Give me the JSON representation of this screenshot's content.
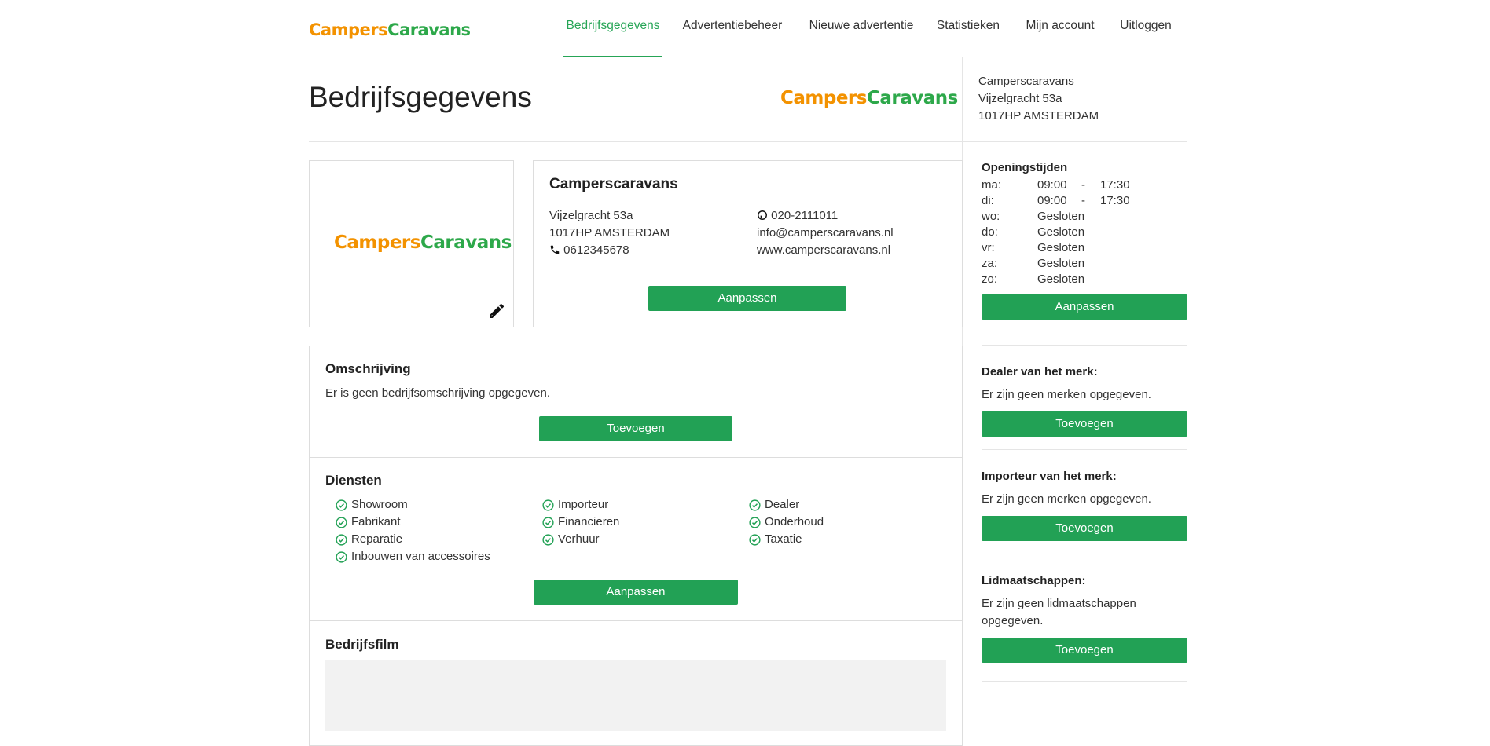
{
  "brand": {
    "part1": "Campers",
    "part2": "Caravans",
    "color1": "#f39200",
    "color2": "#2da84a"
  },
  "nav": {
    "items": [
      {
        "label": "Bedrijfsgegevens",
        "active": true
      },
      {
        "label": "Advertentiebeheer",
        "active": false
      },
      {
        "label": "Nieuwe advertentie",
        "active": false
      },
      {
        "label": "Statistieken",
        "active": false
      },
      {
        "label": "Mijn account",
        "active": false
      },
      {
        "label": "Uitloggen",
        "active": false
      }
    ],
    "accent": "#26a556"
  },
  "page": {
    "title": "Bedrijfsgegevens"
  },
  "sidebar_address": {
    "name": "Camperscaravans",
    "street": "Vijzelgracht 53a",
    "city": "1017HP AMSTERDAM"
  },
  "company": {
    "name": "Camperscaravans",
    "street": "Vijzelgracht  53a",
    "city": "1017HP  AMSTERDAM",
    "mobile": "0612345678",
    "phone": "020-2111011",
    "email": "info@camperscaravans.nl",
    "website": "www.camperscaravans.nl",
    "edit_button": "Aanpassen"
  },
  "description": {
    "title": "Omschrijving",
    "text": "Er is geen bedrijfsomschrijving opgegeven.",
    "button": "Toevoegen"
  },
  "services": {
    "title": "Diensten",
    "items": [
      "Showroom",
      "Importeur",
      "Dealer",
      "Fabrikant",
      "Financieren",
      "Onderhoud",
      "Reparatie",
      "Verhuur",
      "Taxatie",
      "Inbouwen van accessoires"
    ],
    "button": "Aanpassen"
  },
  "film": {
    "title": "Bedrijfsfilm"
  },
  "hours": {
    "title": "Openingstijden",
    "rows": [
      {
        "day": "ma:",
        "open": "09:00",
        "sep": "-",
        "close": "17:30"
      },
      {
        "day": "di:",
        "open": "09:00",
        "sep": "-",
        "close": "17:30"
      },
      {
        "day": "wo:",
        "open": "Gesloten",
        "sep": "",
        "close": ""
      },
      {
        "day": "do:",
        "open": "Gesloten",
        "sep": "",
        "close": ""
      },
      {
        "day": "vr:",
        "open": "Gesloten",
        "sep": "",
        "close": ""
      },
      {
        "day": "za:",
        "open": "Gesloten",
        "sep": "",
        "close": ""
      },
      {
        "day": "zo:",
        "open": "Gesloten",
        "sep": "",
        "close": ""
      }
    ],
    "button": "Aanpassen"
  },
  "dealer": {
    "title": "Dealer van het merk:",
    "text": "Er zijn geen merken opgegeven.",
    "button": "Toevoegen"
  },
  "importer": {
    "title": "Importeur van het merk:",
    "text": "Er zijn geen merken opgegeven.",
    "button": "Toevoegen"
  },
  "memberships": {
    "title": "Lidmaatschappen:",
    "text": "Er zijn geen lidmaatschappen opgegeven.",
    "button": "Toevoegen"
  }
}
